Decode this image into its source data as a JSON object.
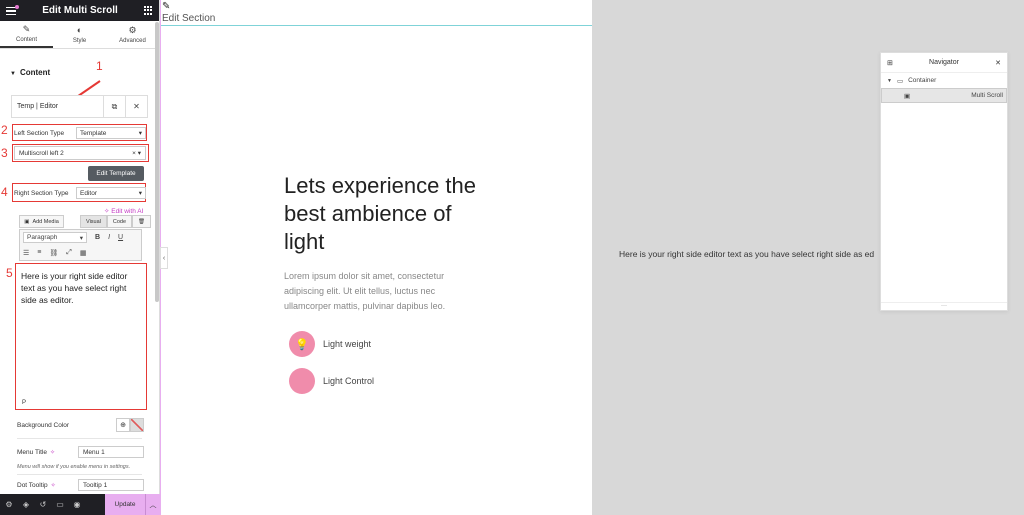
{
  "panel": {
    "title": "Edit Multi Scroll",
    "tabs": [
      {
        "label": "Content",
        "icon": "pencil-icon"
      },
      {
        "label": "Style",
        "icon": "contrast-icon"
      },
      {
        "label": "Advanced",
        "icon": "gear-icon"
      }
    ],
    "section_title": "Content",
    "template_row": {
      "label": "Temp | Editor"
    },
    "left_section_type": {
      "label": "Left Section Type",
      "value": "Template"
    },
    "multiscroll_select": {
      "value": "Multiscroll left 2"
    },
    "edit_template_label": "Edit Template",
    "right_section_type": {
      "label": "Right Section Type",
      "value": "Editor"
    },
    "edit_with_ai": "Edit with AI",
    "add_media_label": "Add Media",
    "view_tabs": [
      "Visual",
      "Code"
    ],
    "paragraph_select": "Paragraph",
    "editor_text": "Here is your right side editor text as you have select right side as editor.",
    "editor_path": "P",
    "background_color_label": "Background Color",
    "menu_title": {
      "label": "Menu Title",
      "value": "Menu 1"
    },
    "menu_note": "Menu will show if you enable menu in settings.",
    "dot_tooltip": {
      "label": "Dot Tooltip",
      "value": "Tooltip 1"
    },
    "update_label": "Update"
  },
  "annotations": [
    "1",
    "2",
    "3",
    "4",
    "5"
  ],
  "canvas": {
    "edit_section_label": "Edit Section",
    "headline": "Lets experience the best ambience of light",
    "lorem": "Lorem ipsum dolor sit amet, consectetur adipiscing elit. Ut elit tellus, luctus nec ullamcorper mattis, pulvinar dapibus leo.",
    "features": [
      "Light weight",
      "Light Control"
    ],
    "right_text": "Here is your right side editor text as you have select right side as ed"
  },
  "navigator": {
    "title": "Navigator",
    "items": [
      "Container",
      "Multi Scroll"
    ]
  },
  "colors": {
    "accent_pink": "#f08cab",
    "annotation_red": "#e53935",
    "update_button": "#e8aef0",
    "header_dark": "#1f1f24"
  }
}
